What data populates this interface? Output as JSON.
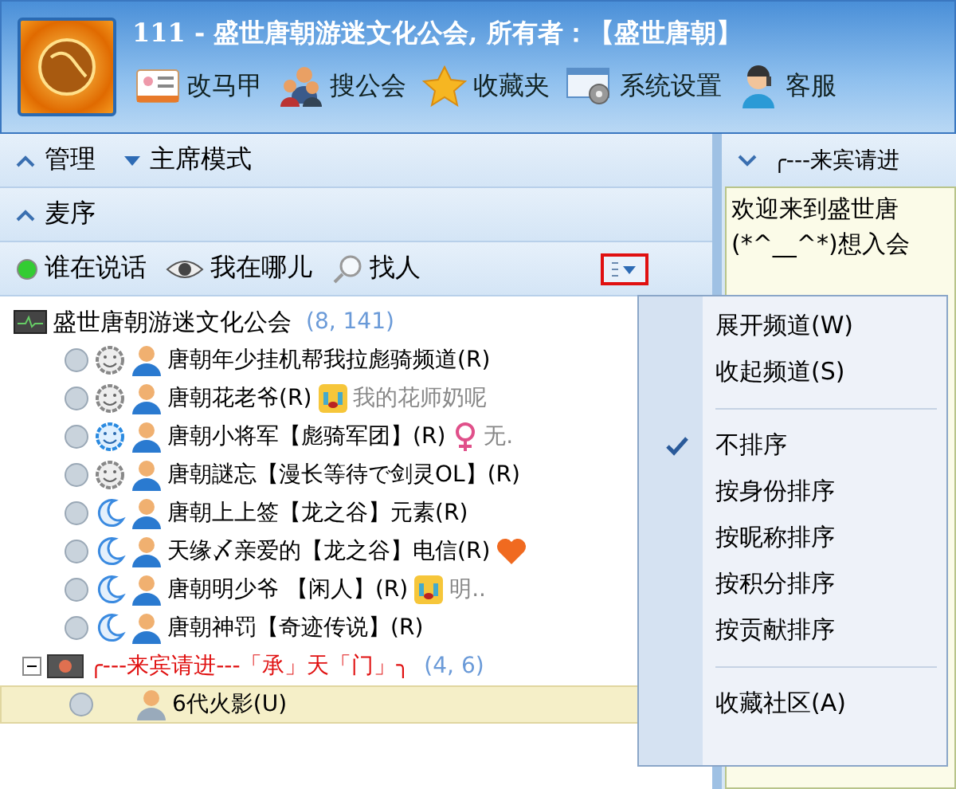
{
  "window": {
    "title": "111 - 盛世唐朝游迷文化公会, 所有者：【盛世唐朝】"
  },
  "toolbar": [
    {
      "label": "改马甲",
      "kind": "card"
    },
    {
      "label": "搜公会",
      "kind": "people"
    },
    {
      "label": "收藏夹",
      "kind": "star"
    },
    {
      "label": "系统设置",
      "kind": "gear"
    },
    {
      "label": "客服",
      "kind": "agent"
    }
  ],
  "sections": [
    {
      "label": "管理",
      "expanded": true
    },
    {
      "label": "主席模式",
      "expanded": false
    }
  ],
  "queue": {
    "label": "麦序",
    "expanded": true
  },
  "tools": [
    {
      "label": "谁在说话",
      "kind": "dot"
    },
    {
      "label": "我在哪儿",
      "kind": "eye"
    },
    {
      "label": "找人",
      "kind": "search"
    }
  ],
  "tree": {
    "name": "盛世唐朝游迷文化公会",
    "count": "(8, 141)",
    "children": [
      {
        "name": "唐朝年少挂机帮我拉彪骑频道(R)",
        "kind": "idle",
        "selected": false
      },
      {
        "name": "唐朝花老爷(R)",
        "kind": "idle",
        "emote": {
          "kind": "cry"
        },
        "note": "我的花师奶呢",
        "selected": false
      },
      {
        "name": "唐朝小将军【彪骑军团】(R)",
        "kind": "online",
        "emote": {
          "kind": "female"
        },
        "note": "无.",
        "selected": false
      },
      {
        "name": "唐朝謎忘【漫长等待で剑灵OL】(R)",
        "kind": "idle",
        "selected": false
      },
      {
        "name": "唐朝上上签【龙之谷】元素(R)",
        "kind": "sleep",
        "selected": false
      },
      {
        "name": "天缘〆亲爱的【龙之谷】电信(R)",
        "kind": "sleep",
        "emote": {
          "kind": "heart"
        },
        "selected": false
      },
      {
        "name": "唐朝明少爷    【闲人】(R)",
        "kind": "sleep",
        "emote": {
          "kind": "cry"
        },
        "note": "明..",
        "selected": false
      },
      {
        "name": "唐朝神罚【奇迹传说】(R)",
        "kind": "sleep",
        "selected": false
      },
      {
        "kind": "channel",
        "name": "╭---来宾请进---「承」天「门」╮",
        "count": "(4, 6)",
        "expanded": true,
        "children": [
          {
            "name": "6代火影(U)",
            "kind": "plain",
            "selected": true
          }
        ]
      }
    ]
  },
  "right_panel": {
    "title": "╭---来宾请进",
    "lines": [
      "欢迎来到盛世唐",
      "(*^__^*)想入会"
    ]
  },
  "menu": [
    {
      "kind": "item",
      "label": "展开频道(W)",
      "checked": false
    },
    {
      "kind": "item",
      "label": "收起频道(S)",
      "checked": false
    },
    {
      "kind": "separator"
    },
    {
      "kind": "item",
      "label": "不排序",
      "checked": true
    },
    {
      "kind": "item",
      "label": "按身份排序",
      "checked": false
    },
    {
      "kind": "item",
      "label": "按昵称排序",
      "checked": false
    },
    {
      "kind": "item",
      "label": "按积分排序",
      "checked": false
    },
    {
      "kind": "item",
      "label": "按贡献排序",
      "checked": false
    },
    {
      "kind": "separator"
    },
    {
      "kind": "item",
      "label": "收藏社区(A)",
      "checked": false
    }
  ]
}
